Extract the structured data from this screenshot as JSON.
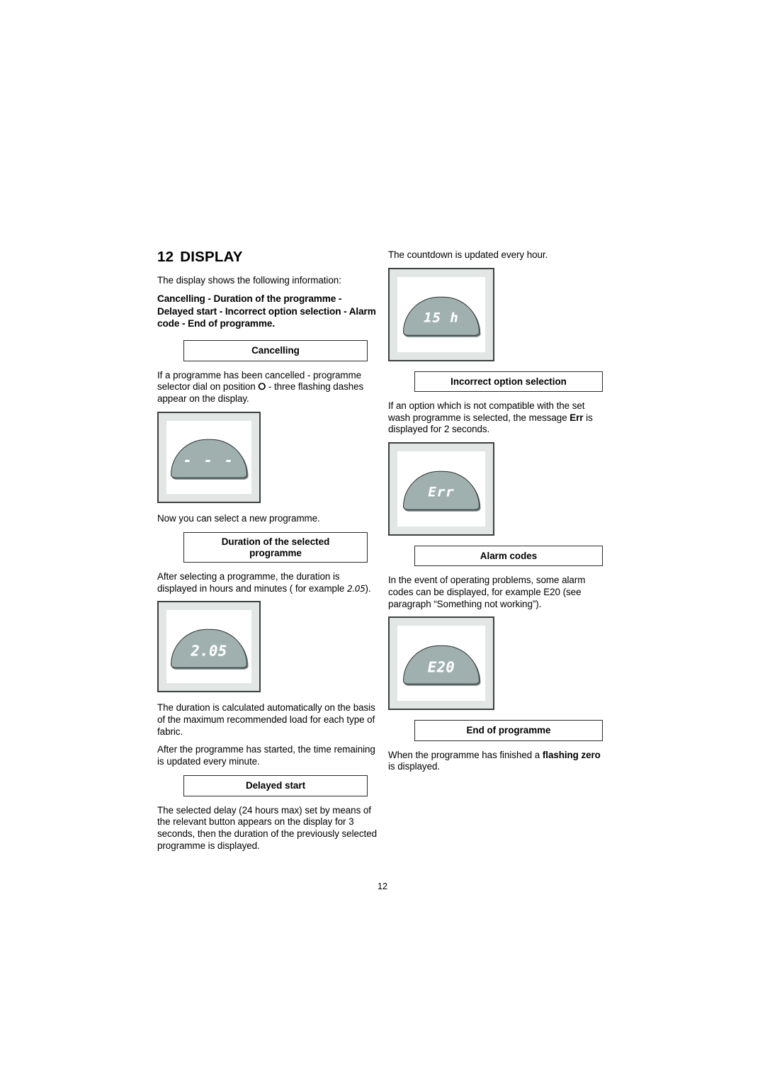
{
  "document": {
    "chapter_number": "12",
    "chapter_title": "DISPLAY",
    "page_number": "12"
  },
  "left_column": {
    "intro": "The display shows the following information:",
    "summary_bold": "Cancelling - Duration of the programme - Delayed start - Incorrect option selection - Alarm code - End of programme.",
    "sections": [
      {
        "header": "Cancelling",
        "body_before": "If a programme has been cancelled - programme selector dial on position",
        "ring_symbol": "⬤",
        "body_after": "- three flashing dashes appear on the display.",
        "display_value": "- - -",
        "body_following": "Now you can select a new programme."
      },
      {
        "header_line1": "Duration of the selected",
        "header_line2": "programme",
        "body_before": "After selecting a programme, the duration is displayed in hours and minutes ( for example",
        "inline_value": "2.05",
        "body_after": ").",
        "display_value": "2.05",
        "body_following_1": "The duration is calculated automatically on the basis of the maximum recommended load for each type of fabric.",
        "body_following_2": "After the programme has started, the time remaining is updated every minute."
      },
      {
        "header": "Delayed start",
        "body": "The selected delay (24 hours max) set by means of the relevant button appears on the display for 3 seconds, then the duration of the previously selected programme is displayed."
      }
    ]
  },
  "right_column": {
    "countdown_note": "The countdown is updated every hour.",
    "countdown_display_value": "15 h",
    "sections": [
      {
        "header": "Incorrect option selection",
        "body_before": "If an option which is not compatible with the set wash programme is selected, the message",
        "bold_term": "Err",
        "body_after": "is displayed for 2 seconds.",
        "display_value": "Err"
      },
      {
        "header": "Alarm codes",
        "body": "In the event of operating problems, some alarm codes can be displayed, for example E20 (see paragraph “Something not working”).",
        "display_value": "E20"
      },
      {
        "header": "End of programme",
        "body_before": "When the programme has finished a",
        "bold_term": "flashing zero",
        "body_after": "is displayed."
      }
    ]
  },
  "colors": {
    "display_frame": "#e2e7e5",
    "display_border": "#3c4040",
    "dome_fill": "#9fb0ae",
    "dome_outline": "#2c3230",
    "lcd_text": "#ffffff"
  }
}
